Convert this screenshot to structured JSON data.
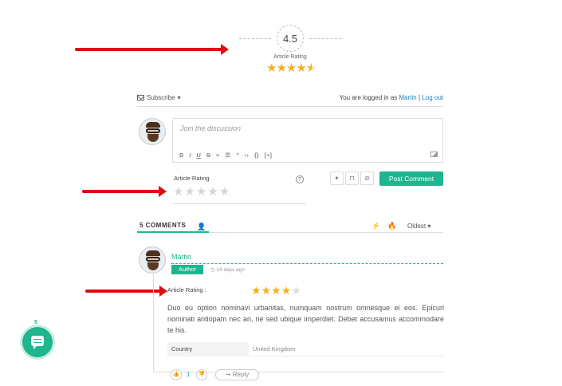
{
  "rating_summary": {
    "value": "4.5",
    "caption": "Article Rating",
    "stars_filled": 4,
    "stars_half": 1
  },
  "topbar": {
    "subscribe_label": "Subscribe",
    "logged_in_prefix": "You are logged in as",
    "user_name": "Martin",
    "separator": "|",
    "logout_label": "Log out"
  },
  "editor": {
    "placeholder": "Join the discussion",
    "toolbar": [
      "B",
      "I",
      "U",
      "S",
      "≡",
      "☰",
      "”",
      "‹›",
      "{}",
      "[+]"
    ]
  },
  "form": {
    "rating_label": "Article Rating",
    "help_glyph": "?",
    "post_button": "Post Comment"
  },
  "comments": {
    "count_label": "5 COMMENTS",
    "sort_label": "Oldest",
    "items": [
      {
        "author": "Martin",
        "badge": "Author",
        "time": "14 days ago",
        "rating_label": "Article Rating :",
        "rating": 4,
        "body": "Duo eu option nominavi urbanitas, numquam nostrum omnesque ei eos. Epicuri nominati antiopam nec an, ne sed ubique imperdiet. Debet accusamus accommodare te his.",
        "field_label": "Country",
        "field_value": "United Kingdom",
        "votes": "1",
        "reply_label": "Reply"
      }
    ]
  },
  "bubble": {
    "count": "5"
  },
  "colors": {
    "accent": "#1fb58e",
    "star": "#f3b21a",
    "arrow": "#d91010"
  }
}
